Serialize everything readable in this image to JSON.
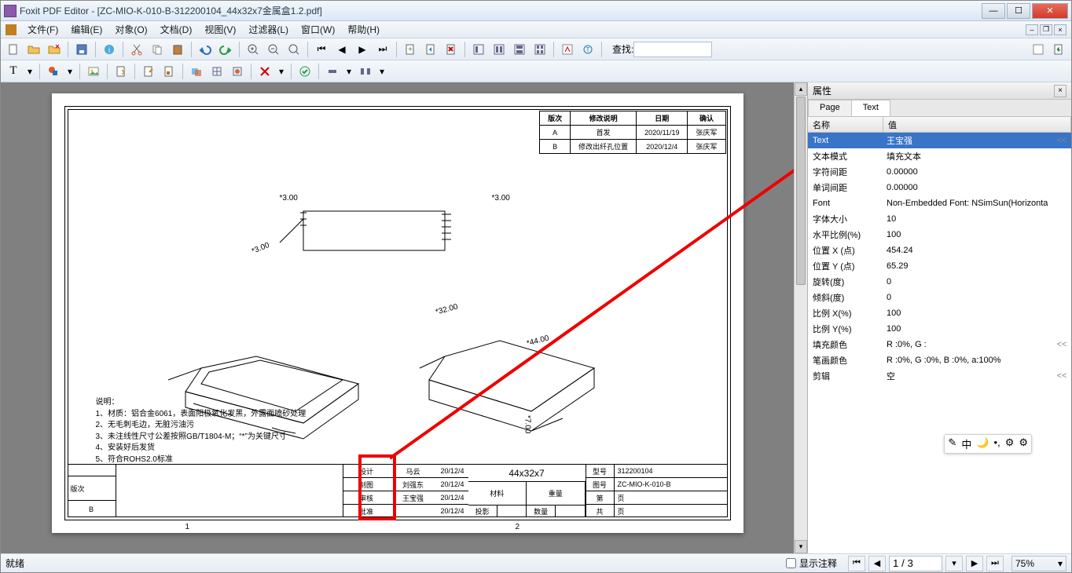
{
  "titlebar": {
    "text": "Foxit PDF Editor - [ZC-MIO-K-010-B-312200104_44x32x7金属盒1.2.pdf]"
  },
  "menu": [
    "文件(F)",
    "编辑(E)",
    "对象(O)",
    "文档(D)",
    "视图(V)",
    "过滤器(L)",
    "窗口(W)",
    "帮助(H)"
  ],
  "search": {
    "label": "查找:",
    "value": ""
  },
  "rev_table": {
    "head": [
      "版次",
      "修改说明",
      "日期",
      "确认"
    ],
    "rows": [
      [
        "A",
        "首发",
        "2020/11/19",
        "张庆军"
      ],
      [
        "B",
        "修改出纤孔位置",
        "2020/12/4",
        "张庆军"
      ]
    ]
  },
  "dims": {
    "u1": "*3.00",
    "u2": "*3.00",
    "u3": "*3.00",
    "m1": "*32.00",
    "m2": "*44.00",
    "m3": "*7.00"
  },
  "notes": {
    "title": "说明：",
    "lines": [
      "1、材质：铝合金6061，表面阳极氧化发黑，外露面喷砂处理",
      "2、无毛刺毛边，无脏污油污",
      "3、未注线性尺寸公差按照GB/T1804-M；“*”为关键尺寸",
      "4、安装好后发货",
      "5、符合ROHS2.0标准"
    ]
  },
  "title_block": {
    "rev_label": "版次",
    "rev_val": "B",
    "sig_labels": [
      "设计",
      "制图",
      "审核",
      "批准"
    ],
    "sig_names": [
      "马云",
      "刘强东",
      "王宝强",
      ""
    ],
    "sig_dates": [
      "20/12/4",
      "20/12/4",
      "20/12/4",
      "20/12/4"
    ],
    "mid_title": "44x32x7",
    "mid_row": [
      "材料",
      "重量"
    ],
    "mid_row2": [
      "投影",
      "",
      "数量",
      ""
    ],
    "right": [
      [
        "型号",
        "312200104"
      ],
      [
        "图号",
        "ZC-MIO-K-010-B"
      ],
      [
        "第",
        "页"
      ],
      [
        "共",
        "页"
      ]
    ]
  },
  "page_foot": [
    "1",
    "2"
  ],
  "side": {
    "title": "属性",
    "tabs": [
      "Page",
      "Text"
    ],
    "head": [
      "名称",
      "值"
    ],
    "rows": [
      [
        "Text",
        "王宝强",
        "sel",
        "<<"
      ],
      [
        "文本模式",
        "填充文本",
        "",
        ""
      ],
      [
        "字符间距",
        "0.00000",
        "",
        ""
      ],
      [
        "单词间距",
        "0.00000",
        "",
        ""
      ],
      [
        "Font",
        "Non-Embedded Font: NSimSun(Horizonta",
        "",
        ""
      ],
      [
        "字体大小",
        "10",
        "",
        ""
      ],
      [
        "水平比例(%)",
        "100",
        "",
        ""
      ],
      [
        "位置 X (点)",
        "454.24",
        "",
        ""
      ],
      [
        "位置 Y (点)",
        "65.29",
        "",
        ""
      ],
      [
        "旋转(度)",
        "0",
        "",
        ""
      ],
      [
        "倾斜(度)",
        "0",
        "",
        ""
      ],
      [
        "比例 X(%)",
        "100",
        "",
        ""
      ],
      [
        "比例 Y(%)",
        "100",
        "",
        ""
      ],
      [
        "填充颜色",
        "R :0%, G :",
        "",
        "<<"
      ],
      [
        "笔画颜色",
        "R :0%, G :0%, B :0%, a:100%",
        "",
        ""
      ],
      [
        "剪辑",
        "空",
        "",
        "<<"
      ]
    ]
  },
  "ime": [
    "✎",
    "中",
    "🌙",
    "•,",
    "⚙",
    "⚙"
  ],
  "status": {
    "ready": "就绪",
    "chk": "显示注释",
    "page": "1 / 3",
    "zoom": "75%"
  }
}
